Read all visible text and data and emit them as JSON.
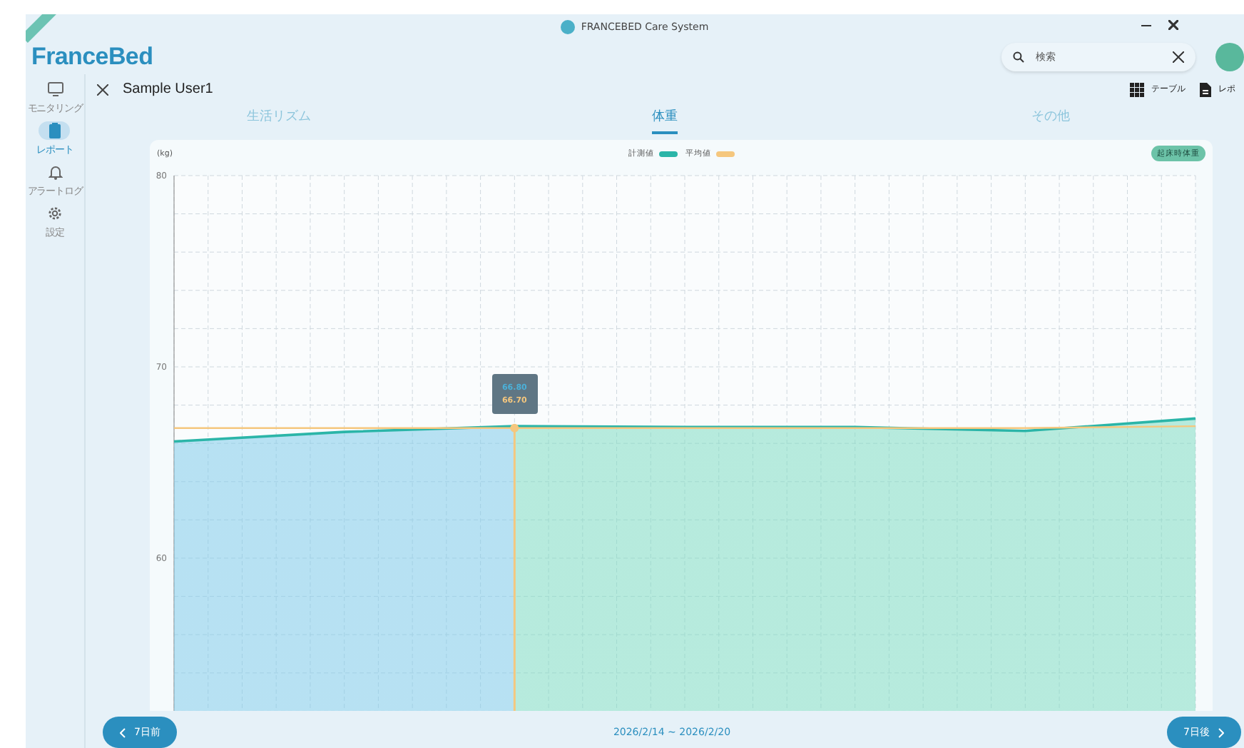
{
  "window": {
    "title": "FRANCEBED Care System"
  },
  "header": {
    "logo": "FranceBed",
    "search": {
      "placeholder": "検索"
    }
  },
  "sidebar": {
    "items": [
      {
        "label": "モニタリング",
        "kind": "monitor",
        "selected": false
      },
      {
        "label": "レポート",
        "kind": "report",
        "selected": true
      },
      {
        "label": "アラートログ",
        "kind": "bell",
        "selected": false
      },
      {
        "label": "設定",
        "kind": "gear",
        "selected": false
      }
    ]
  },
  "user": {
    "name": "Sample User1"
  },
  "toolbar": {
    "buttons": [
      {
        "label": "テーブル",
        "kind": "grid"
      },
      {
        "label": "レポ",
        "kind": "document"
      }
    ]
  },
  "tabs": [
    {
      "label": "生活リズム",
      "selected": false
    },
    {
      "label": "体重",
      "selected": true
    },
    {
      "label": "その他",
      "selected": false
    }
  ],
  "chart": {
    "unit": "(kg)",
    "badge": "起床時体重",
    "tooltip": {
      "values": [
        "66.80",
        "66.70"
      ]
    },
    "chart_data": {
      "type": "area",
      "grid": true,
      "ylim": [
        52,
        80
      ],
      "yticks": [
        60,
        70,
        80
      ],
      "series": [
        {
          "name": "計測値",
          "color": "#2bb5a8",
          "values": [
            66.1,
            66.6,
            66.9,
            66.85,
            66.85,
            66.65,
            67.3
          ]
        },
        {
          "name": "平均値",
          "type": "line",
          "color": "#f5c77e",
          "values": [
            66.8,
            66.8,
            66.8,
            66.8,
            66.8,
            66.8,
            66.9
          ]
        }
      ]
    }
  },
  "footer": {
    "prev": "7日前",
    "next": "7日後",
    "range": "2026/2/14 ~ 2026/2/20"
  }
}
